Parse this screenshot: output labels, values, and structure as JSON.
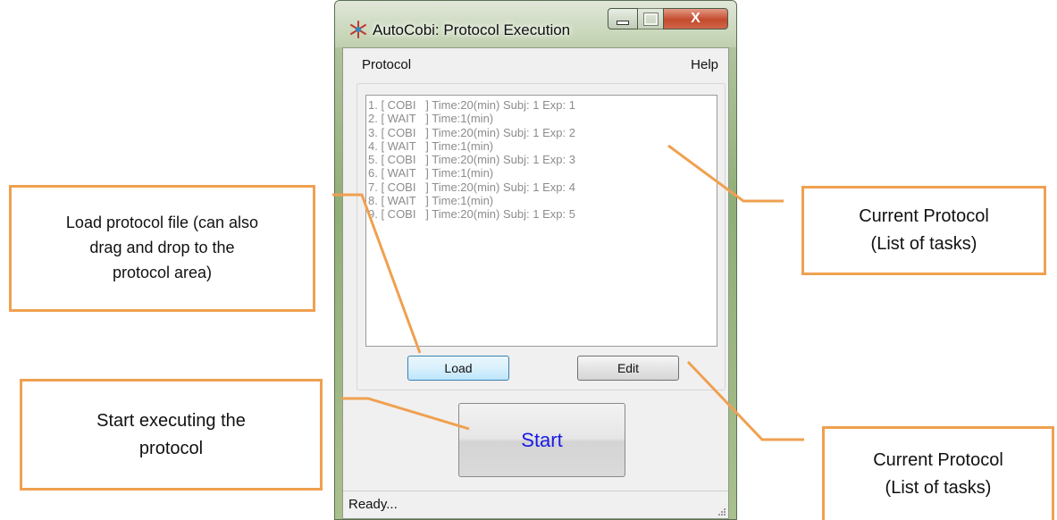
{
  "window": {
    "title": "AutoCobi: Protocol Execution",
    "close_glyph": "X"
  },
  "menu": {
    "protocol": "Protocol",
    "help": "Help"
  },
  "protocol_list": [
    "1. [ COBI   ] Time:20(min) Subj: 1 Exp: 1",
    "2. [ WAIT   ] Time:1(min)",
    "3. [ COBI   ] Time:20(min) Subj: 1 Exp: 2",
    "4. [ WAIT   ] Time:1(min)",
    "5. [ COBI   ] Time:20(min) Subj: 1 Exp: 3",
    "6. [ WAIT   ] Time:1(min)",
    "7. [ COBI   ] Time:20(min) Subj: 1 Exp: 4",
    "8. [ WAIT   ] Time:1(min)",
    "9. [ COBI   ] Time:20(min) Subj: 1 Exp: 5"
  ],
  "buttons": {
    "load": "Load",
    "edit": "Edit",
    "start": "Start"
  },
  "status": "Ready...",
  "callouts": {
    "load": "Load protocol file (can also\ndrag and drop to the\nprotocol area)",
    "start": "Start executing the\nprotocol",
    "current_protocol_top": "Current Protocol\n(List of tasks)",
    "current_protocol_bottom": "Current Protocol\n(List of tasks)"
  },
  "colors": {
    "callout_border": "#f0a050",
    "start_text": "#1a1ae6"
  }
}
